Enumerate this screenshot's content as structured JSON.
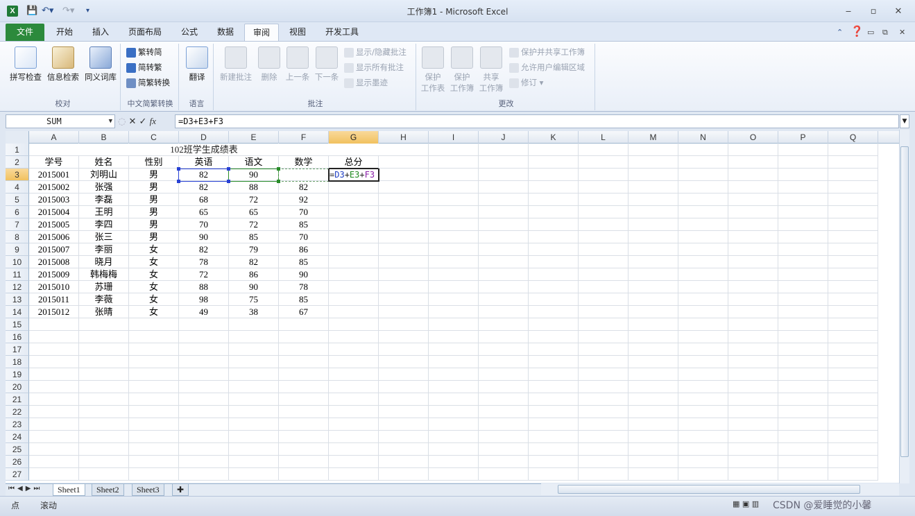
{
  "window": {
    "title": "工作簿1 - Microsoft Excel",
    "app_icon_label": "X"
  },
  "quick_access": {
    "undo_icon": "undo-icon",
    "redo_icon": "redo-icon"
  },
  "tabs": [
    "文件",
    "开始",
    "插入",
    "页面布局",
    "公式",
    "数据",
    "审阅",
    "视图",
    "开发工具"
  ],
  "active_tab": "审阅",
  "ribbon": {
    "proofing": {
      "label": "校对",
      "buttons": [
        "拼写检查",
        "信息检索",
        "同义词库"
      ]
    },
    "chinese_conversion": {
      "label": "中文简繁转换",
      "buttons": [
        "繁转简",
        "简转繁",
        "简繁转换"
      ]
    },
    "language": {
      "label": "语言",
      "buttons": [
        "翻译"
      ]
    },
    "comments": {
      "label": "批注",
      "buttons": [
        "新建批注",
        "删除",
        "上一条",
        "下一条"
      ],
      "small_buttons": [
        "显示/隐藏批注",
        "显示所有批注",
        "显示墨迹"
      ]
    },
    "changes": {
      "label": "更改",
      "buttons": [
        [
          "保护",
          "工作表"
        ],
        [
          "保护",
          "工作簿"
        ],
        [
          "共享",
          "工作簿"
        ]
      ],
      "small_buttons": [
        "保护并共享工作簿",
        "允许用户编辑区域",
        "修订"
      ]
    }
  },
  "formula_bar": {
    "name_box": "SUM",
    "formula": "=D3+E3+F3",
    "fx_label": "fx"
  },
  "columns": [
    "A",
    "B",
    "C",
    "D",
    "E",
    "F",
    "G",
    "H",
    "I",
    "J",
    "K",
    "L",
    "M",
    "N",
    "O",
    "P",
    "Q"
  ],
  "selected_column": "G",
  "selected_row": 3,
  "sheet": {
    "title": "102班学生成绩表",
    "headers": [
      "学号",
      "姓名",
      "性别",
      "英语",
      "语文",
      "数学",
      "总分"
    ],
    "rows": [
      [
        "2015001",
        "刘明山",
        "男",
        "82",
        "90",
        ""
      ],
      [
        "2015002",
        "张强",
        "男",
        "82",
        "88",
        "82"
      ],
      [
        "2015003",
        "李磊",
        "男",
        "68",
        "72",
        "92"
      ],
      [
        "2015004",
        "王明",
        "男",
        "65",
        "65",
        "70"
      ],
      [
        "2015005",
        "李四",
        "男",
        "70",
        "72",
        "85"
      ],
      [
        "2015006",
        "张三",
        "男",
        "90",
        "85",
        "70"
      ],
      [
        "2015007",
        "李丽",
        "女",
        "82",
        "79",
        "86"
      ],
      [
        "2015008",
        "晓月",
        "女",
        "78",
        "82",
        "85"
      ],
      [
        "2015009",
        "韩梅梅",
        "女",
        "72",
        "86",
        "90"
      ],
      [
        "2015010",
        "苏珊",
        "女",
        "88",
        "90",
        "78"
      ],
      [
        "2015011",
        "李薇",
        "女",
        "98",
        "75",
        "85"
      ],
      [
        "2015012",
        "张晴",
        "女",
        "49",
        "38",
        "67"
      ]
    ],
    "editing_formula": {
      "prefix": "=",
      "d": "D3",
      "plus1": "+",
      "e": "E3",
      "plus2": "+",
      "f": "F3"
    }
  },
  "sheet_tabs": [
    "Sheet1",
    "Sheet2",
    "Sheet3"
  ],
  "active_sheet": "Sheet1",
  "status": {
    "mode": "点",
    "scroll": "滚动",
    "watermark": "CSDN @爱睡觉的小馨"
  },
  "colors": {
    "file_tab": "#2c8a3c",
    "ref_d": "#2841d4",
    "ref_e": "#2a8c2a",
    "ref_f": "#8a1fa8",
    "selected_header": "#f1c15f"
  }
}
